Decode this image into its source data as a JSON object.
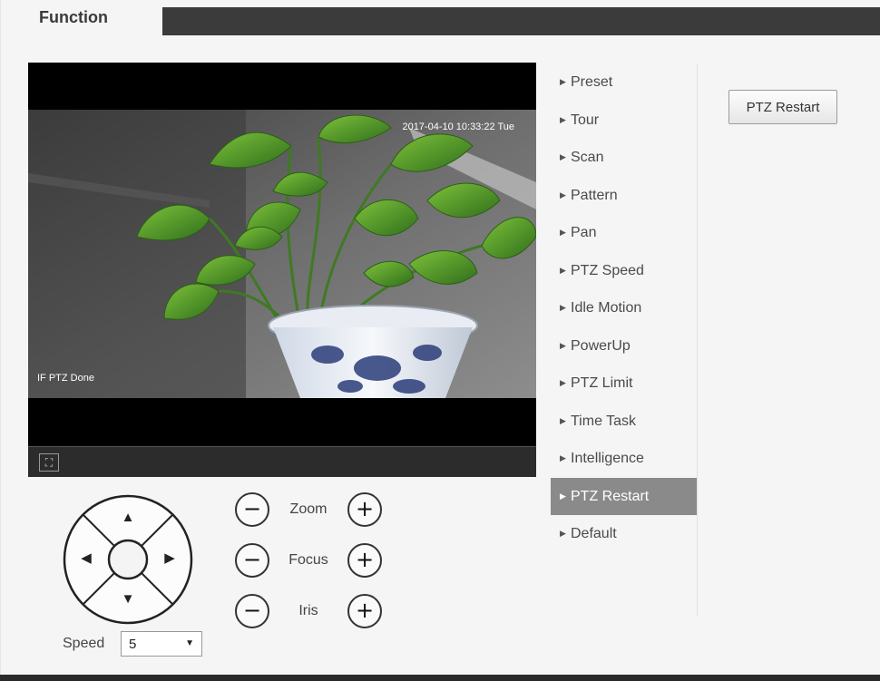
{
  "tab": {
    "label": "Function"
  },
  "video": {
    "timestamp": "2017-04-10 10:33:22 Tue",
    "status_text": "IF PTZ Done",
    "fullscreen_glyph": "⛶"
  },
  "menu": {
    "items": [
      {
        "label": "Preset"
      },
      {
        "label": "Tour"
      },
      {
        "label": "Scan"
      },
      {
        "label": "Pattern"
      },
      {
        "label": "Pan"
      },
      {
        "label": "PTZ Speed"
      },
      {
        "label": "Idle Motion"
      },
      {
        "label": "PowerUp"
      },
      {
        "label": "PTZ Limit"
      },
      {
        "label": "Time Task"
      },
      {
        "label": "Intelligence"
      },
      {
        "label": "PTZ Restart"
      },
      {
        "label": "Default"
      }
    ],
    "active": "PTZ Restart"
  },
  "actions": {
    "restart_label": "PTZ Restart"
  },
  "ptz": {
    "zoom_label": "Zoom",
    "focus_label": "Focus",
    "iris_label": "Iris",
    "minus_glyph": "−",
    "plus_glyph": "+",
    "up_glyph": "▲",
    "down_glyph": "▼",
    "left_glyph": "◀",
    "right_glyph": "▶",
    "speed_label": "Speed",
    "speed_value": "5",
    "caret_glyph": "▼"
  },
  "icons": {
    "menu_arrow": "▶",
    "dpad_arrows": [
      "up-arrow-icon",
      "down-arrow-icon",
      "left-arrow-icon",
      "right-arrow-icon"
    ],
    "fullscreen": "fullscreen-icon"
  },
  "colors": {
    "active_menu_bg": "#8a8a8a",
    "tab_bar": "#3b3b3b",
    "page_bg": "#f5f5f5"
  }
}
